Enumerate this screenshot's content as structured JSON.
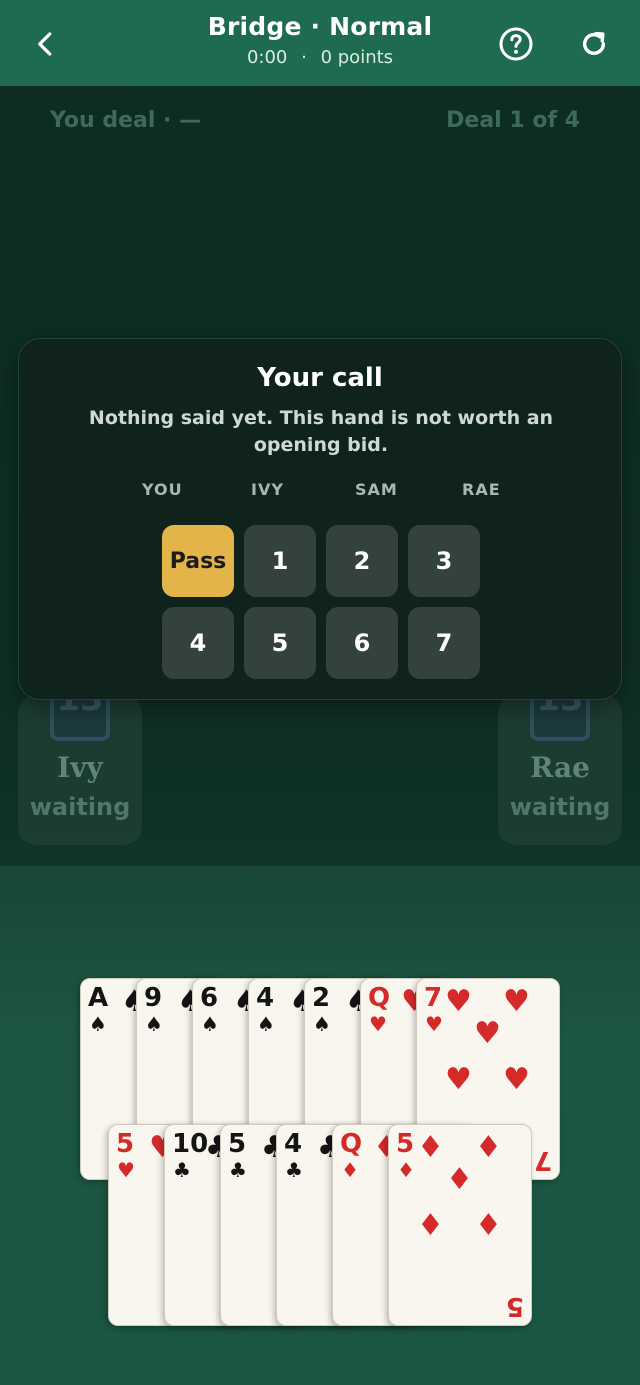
{
  "header": {
    "title": "Bridge · Normal",
    "time": "0:00",
    "separator": "·",
    "points": "0 points"
  },
  "table": {
    "dealer_info": "You deal · —",
    "deal_info": "Deal 1 of 4",
    "players": [
      {
        "name": "Ivy",
        "status": "waiting",
        "cards": "13"
      },
      {
        "name": "Rae",
        "status": "waiting",
        "cards": "13"
      }
    ]
  },
  "modal": {
    "title": "Your call",
    "message": "Nothing said yet. This hand is not worth an opening bid.",
    "columns": [
      "YOU",
      "IVY",
      "SAM",
      "RAE"
    ],
    "bids": [
      "Pass",
      "1",
      "2",
      "3",
      "4",
      "5",
      "6",
      "7"
    ],
    "selected_bid": "Pass"
  },
  "hand": {
    "row1": [
      {
        "rank": "A",
        "suit": "♠",
        "color": "black"
      },
      {
        "rank": "9",
        "suit": "♠",
        "color": "black"
      },
      {
        "rank": "6",
        "suit": "♠",
        "color": "black"
      },
      {
        "rank": "4",
        "suit": "♠",
        "color": "black"
      },
      {
        "rank": "2",
        "suit": "♠",
        "color": "black"
      },
      {
        "rank": "Q",
        "suit": "♥",
        "color": "red"
      },
      {
        "rank": "7",
        "suit": "♥",
        "color": "red"
      }
    ],
    "row2": [
      {
        "rank": "5",
        "suit": "♥",
        "color": "red"
      },
      {
        "rank": "10",
        "suit": "♣",
        "color": "black"
      },
      {
        "rank": "5",
        "suit": "♣",
        "color": "black"
      },
      {
        "rank": "4",
        "suit": "♣",
        "color": "black"
      },
      {
        "rank": "Q",
        "suit": "♦",
        "color": "red"
      },
      {
        "rank": "5",
        "suit": "♦",
        "color": "red"
      }
    ]
  },
  "colors": {
    "header_bg": "#1f6b4f",
    "modal_bg": "#0f231c",
    "pass_button": "#e3b44a",
    "bid_button": "#34423e",
    "red_suit": "#d42a2a"
  }
}
